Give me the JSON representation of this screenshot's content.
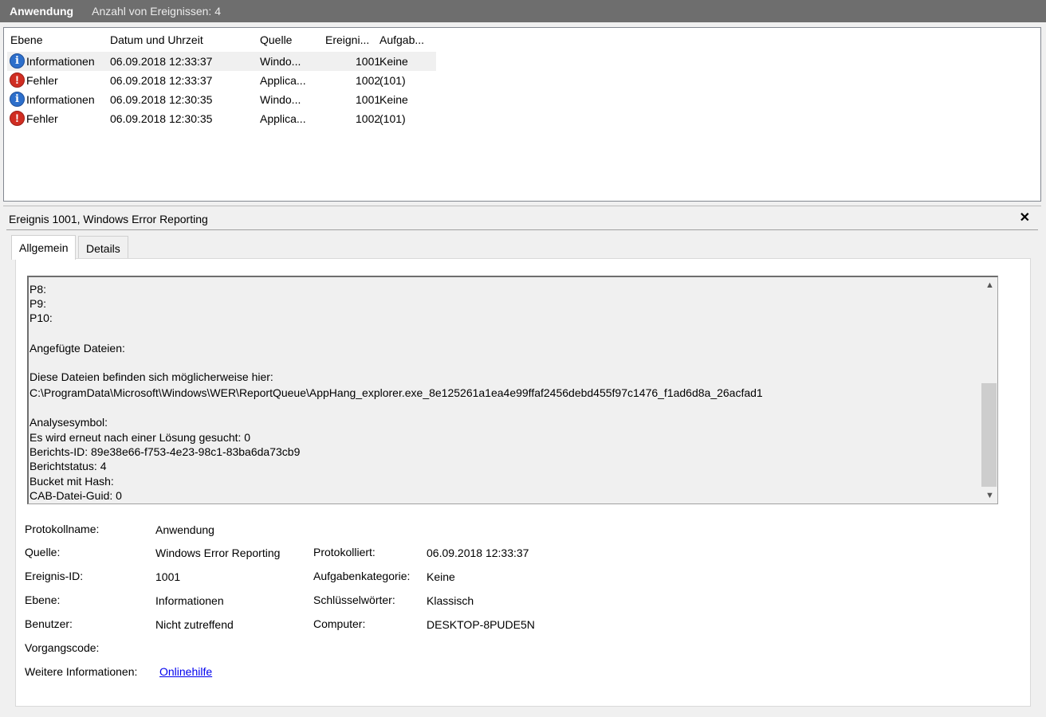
{
  "title_bar": {
    "log_name": "Anwendung",
    "event_count": "Anzahl von Ereignissen: 4"
  },
  "list": {
    "columns": [
      "Ebene",
      "Datum und Uhrzeit",
      "Quelle",
      "Ereigni...",
      "Aufgab..."
    ],
    "rows": [
      {
        "icon": "info-icon",
        "level": "Informationen",
        "datetime": "06.09.2018 12:33:37",
        "source": "Windo...",
        "event_id": "1001",
        "task": "Keine"
      },
      {
        "icon": "error-icon",
        "level": "Fehler",
        "datetime": "06.09.2018 12:33:37",
        "source": "Applica...",
        "event_id": "1002",
        "task": "(101)"
      },
      {
        "icon": "info-icon",
        "level": "Informationen",
        "datetime": "06.09.2018 12:30:35",
        "source": "Windo...",
        "event_id": "1001",
        "task": "Keine"
      },
      {
        "icon": "error-icon",
        "level": "Fehler",
        "datetime": "06.09.2018 12:30:35",
        "source": "Applica...",
        "event_id": "1002",
        "task": "(101)"
      }
    ]
  },
  "detail": {
    "title": "Ereignis 1001, Windows Error Reporting",
    "close_glyph": "✕",
    "tabs": [
      "Allgemein",
      "Details"
    ],
    "text_lines": [
      "P8:",
      "P9:",
      "P10:",
      "",
      "Angefügte Dateien:",
      "",
      "Diese Dateien befinden sich möglicherweise hier:",
      "C:\\ProgramData\\Microsoft\\Windows\\WER\\ReportQueue\\AppHang_explorer.exe_8e125261a1ea4e99ffaf2456debd455f97c1476_f1ad6d8a_26acfad1",
      "",
      "Analysesymbol:",
      "Es wird erneut nach einer Lösung gesucht: 0",
      "Berichts-ID: 89e38e66-f753-4e23-98c1-83ba6da73cb9",
      "Berichtstatus: 4",
      "Bucket mit Hash:",
      "CAB-Datei-Guid: 0"
    ],
    "props": {
      "protokollname_label": "Protokollname:",
      "protokollname": "Anwendung",
      "quelle_label": "Quelle:",
      "quelle": "Windows Error Reporting",
      "protokolliert_label": "Protokolliert:",
      "protokolliert": "06.09.2018 12:33:37",
      "ereignis_id_label": "Ereignis-ID:",
      "ereignis_id": "1001",
      "aufgabenkategorie_label": "Aufgabenkategorie:",
      "aufgabenkategorie": "Keine",
      "ebene_label": "Ebene:",
      "ebene": "Informationen",
      "schluesselwoerter_label": "Schlüsselwörter:",
      "schluesselwoerter": "Klassisch",
      "benutzer_label": "Benutzer:",
      "benutzer": "Nicht zutreffend",
      "computer_label": "Computer:",
      "computer": "DESKTOP-8PUDE5N",
      "vorgangscode_label": "Vorgangscode:",
      "weitere_label": "Weitere Informationen:",
      "weitere_link": "Onlinehilfe"
    }
  }
}
